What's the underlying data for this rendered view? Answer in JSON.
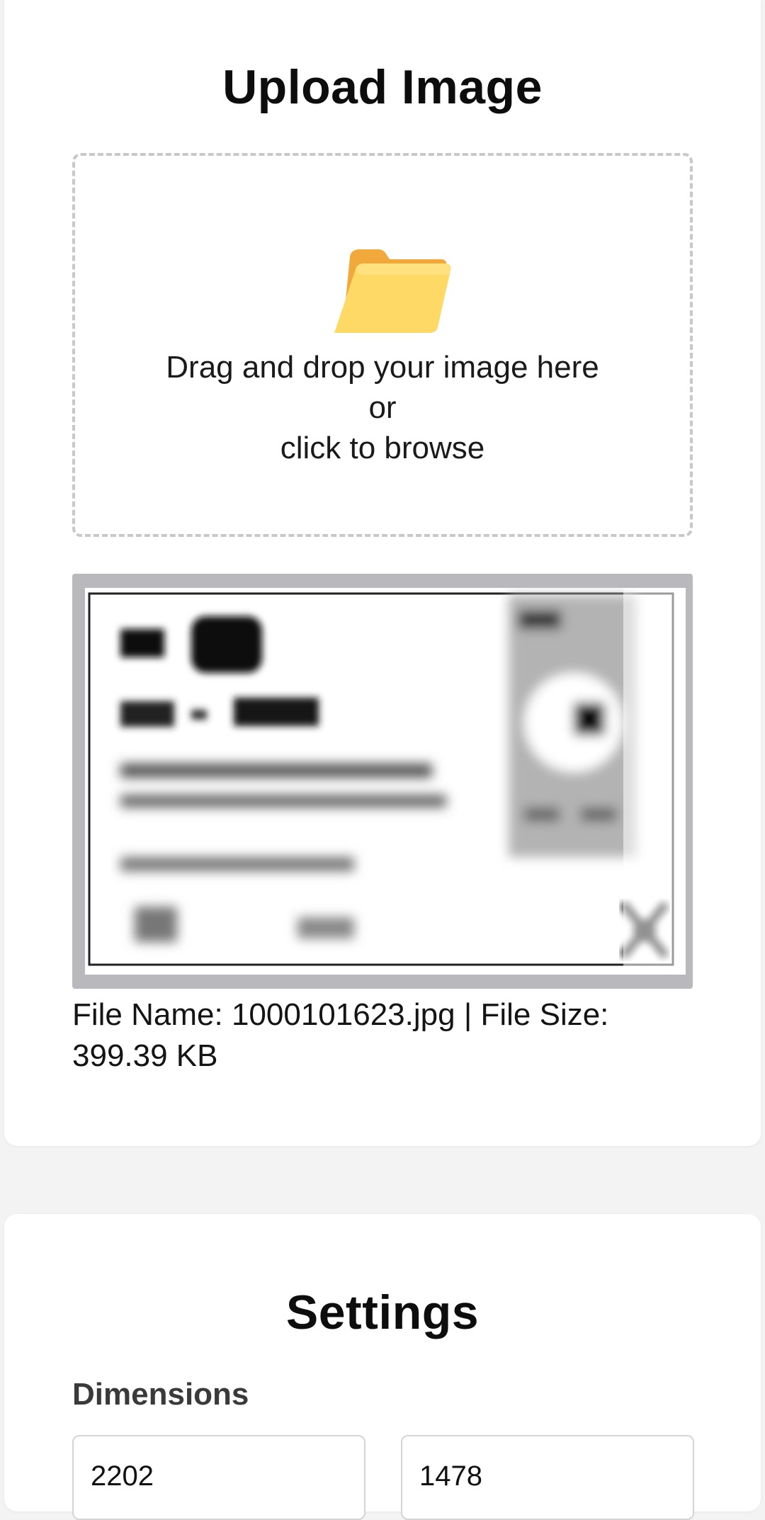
{
  "upload": {
    "title": "Upload Image",
    "dropzone": {
      "line1": "Drag and drop your image here",
      "line2": "or",
      "line3": "click to browse",
      "icon": "folder-icon"
    },
    "file_info_label": "File Name: 1000101623.jpg | File Size: 399.39 KB"
  },
  "settings": {
    "title": "Settings",
    "dimensions_label": "Dimensions",
    "width_value": "2202",
    "height_value": "1478"
  },
  "colors": {
    "page_bg": "#f3f3f3",
    "card_bg": "#ffffff",
    "dashed_border": "#c8c8c8",
    "folder_front": "#ffd966",
    "folder_back": "#f2a93b"
  }
}
